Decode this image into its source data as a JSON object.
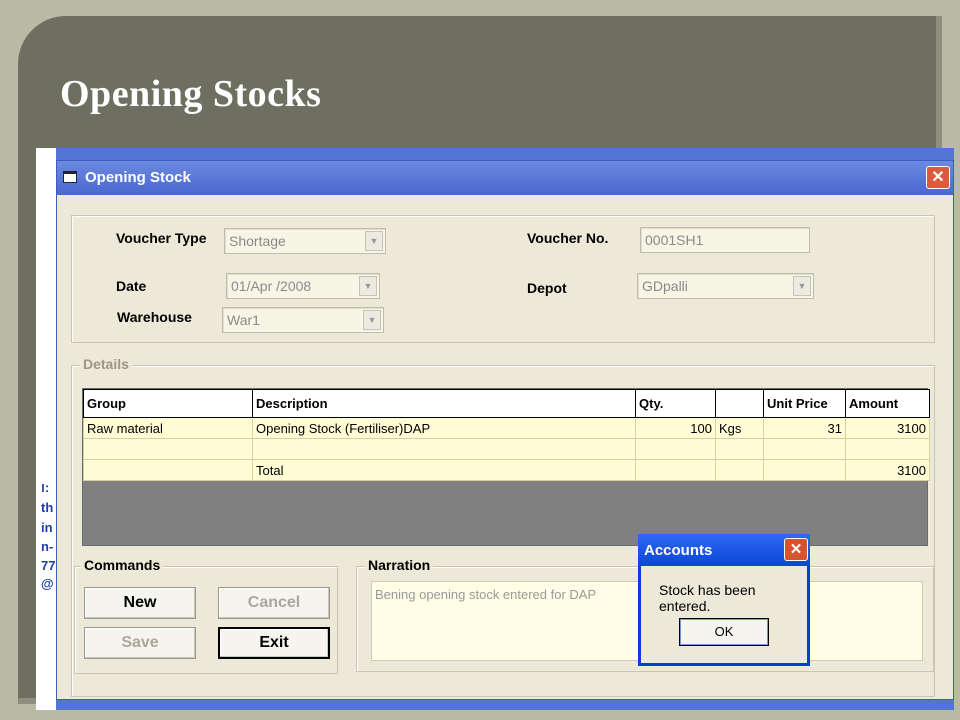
{
  "slide": {
    "title": "Opening Stocks"
  },
  "left_strip": [
    "ו:",
    "th",
    "in",
    "n-",
    "77",
    "@"
  ],
  "window": {
    "title": "Opening Stock",
    "close_glyph": "✕"
  },
  "header": {
    "voucher_type_label": "Voucher Type",
    "voucher_type_value": "Shortage",
    "date_label": "Date",
    "date_value": "01/Apr /2008",
    "warehouse_label": "Warehouse",
    "warehouse_value": "War1",
    "voucher_no_label": "Voucher No.",
    "voucher_no_value": "0001SH1",
    "depot_label": "Depot",
    "depot_value": "GDpalli"
  },
  "details": {
    "legend": "Details",
    "columns": [
      "Group",
      "Description",
      "Qty.",
      "",
      "Unit Price",
      "Amount"
    ],
    "rows": [
      {
        "group": "Raw material",
        "description": "Opening Stock (Fertiliser)DAP",
        "qty": "100",
        "unit": "Kgs",
        "unit_price": "31",
        "amount": "3100"
      },
      {
        "group": "",
        "description": "",
        "qty": "",
        "unit": "",
        "unit_price": "",
        "amount": ""
      },
      {
        "group": "",
        "description": "Total",
        "qty": "",
        "unit": "",
        "unit_price": "",
        "amount": "3100"
      }
    ]
  },
  "commands": {
    "legend": "Commands",
    "new_label": "New",
    "cancel_label": "Cancel",
    "save_label": "Save",
    "exit_label": "Exit"
  },
  "narration": {
    "legend": "Narration",
    "text": "Bening opening stock entered for DAP"
  },
  "dialog": {
    "title": "Accounts",
    "message": "Stock has been entered.",
    "ok_label": "OK",
    "close_glyph": "✕"
  },
  "colors": {
    "slide_bg": "#6f6f61",
    "titlebar_blue": "#4a68cf",
    "dialog_blue": "#0b46d8",
    "grid_cell": "#fffcd6"
  }
}
